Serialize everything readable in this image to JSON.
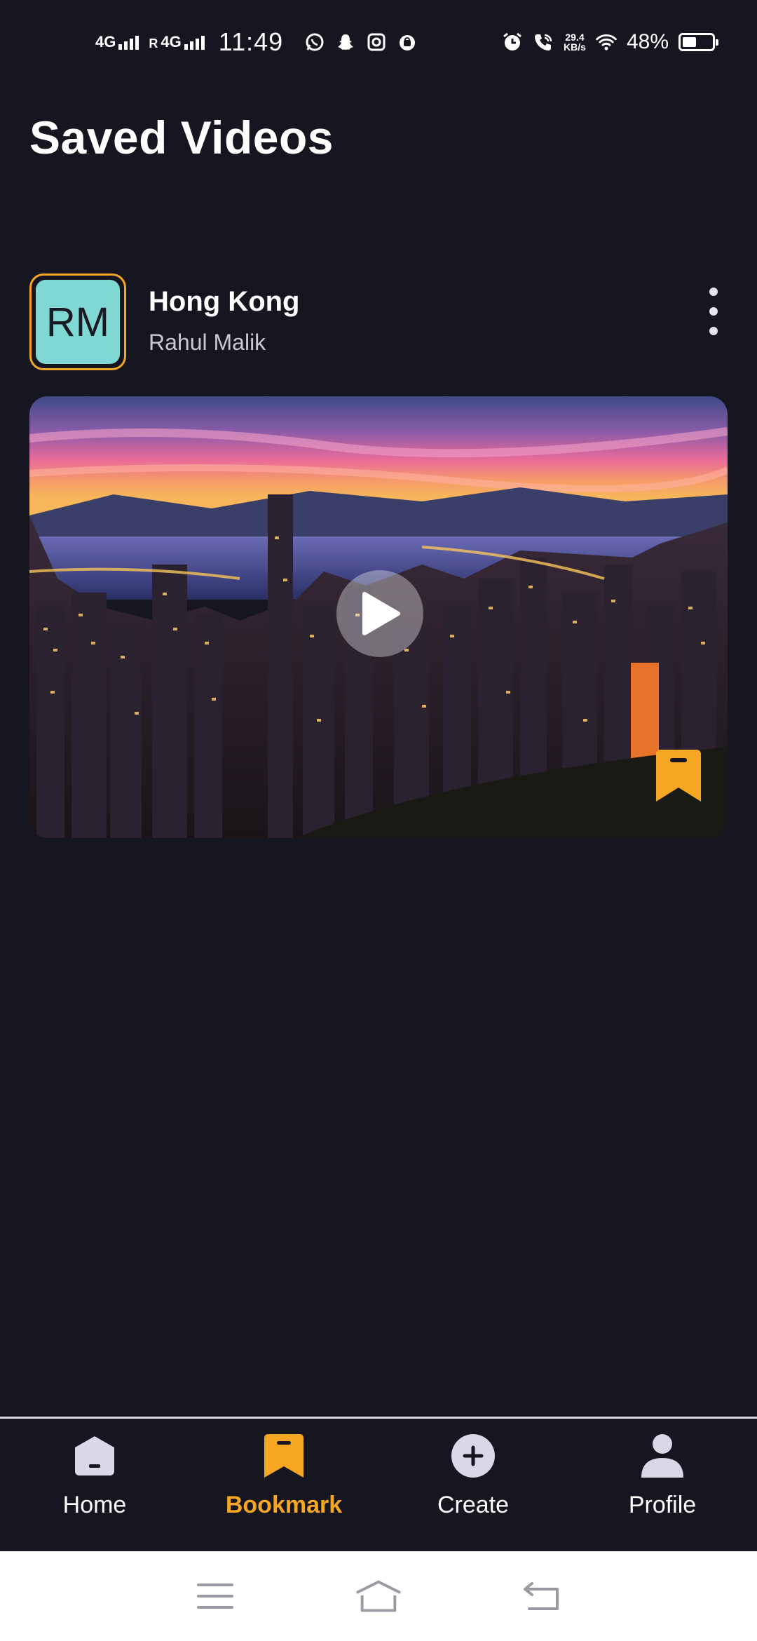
{
  "status_bar": {
    "network1": "4G",
    "roaming": "R",
    "network2": "4G",
    "time": "11:49",
    "speed_value": "29.4",
    "speed_unit": "KB/s",
    "battery_percent": "48%",
    "battery_level": 0.48,
    "notification_icons": [
      "whatsapp-icon",
      "snapchat-icon",
      "instagram-icon",
      "shopping-bag-icon"
    ],
    "system_icons": [
      "alarm-icon",
      "wifi-calling-icon",
      "wifi-icon"
    ]
  },
  "page": {
    "title": "Saved Videos"
  },
  "post": {
    "avatar_initials": "RM",
    "title": "Hong Kong",
    "author": "Rahul Malik"
  },
  "bottom_nav": {
    "items": [
      {
        "label": "Home",
        "icon": "home-icon",
        "active": false
      },
      {
        "label": "Bookmark",
        "icon": "bookmark-icon",
        "active": true
      },
      {
        "label": "Create",
        "icon": "add-circle-icon",
        "active": false
      },
      {
        "label": "Profile",
        "icon": "profile-icon",
        "active": false
      }
    ]
  },
  "colors": {
    "background": "#161620",
    "accent": "#f5a623",
    "avatar_bg": "#7fd8d3"
  }
}
